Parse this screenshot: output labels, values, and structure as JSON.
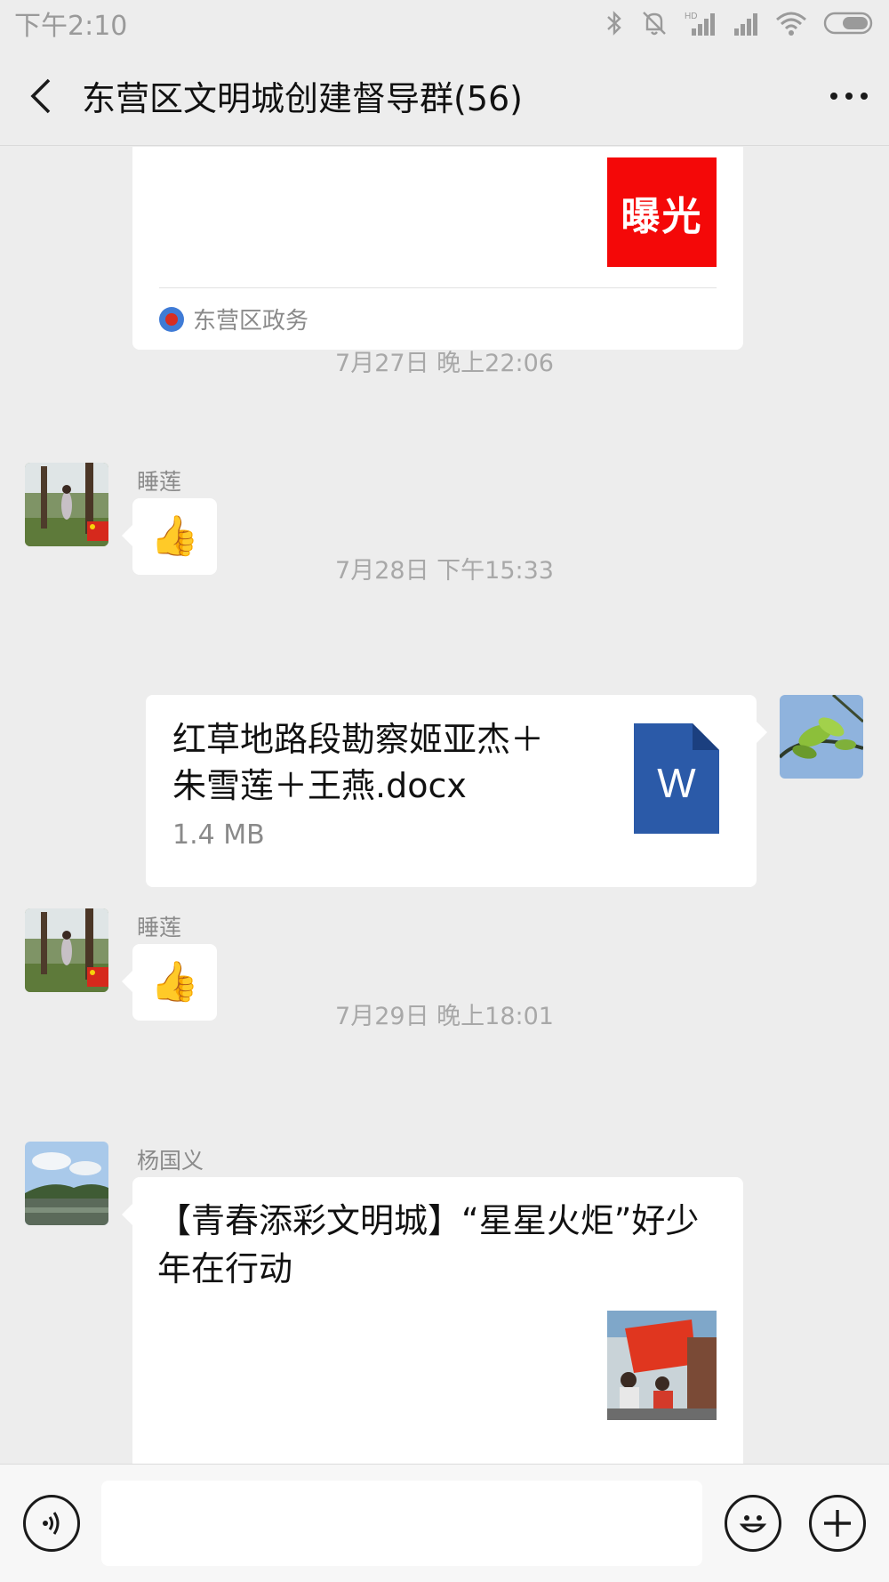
{
  "status": {
    "time": "下午2:10"
  },
  "header": {
    "title": "东营区文明城创建督导群(56)"
  },
  "messages": {
    "article1": {
      "image_text": "曝光",
      "source": "东营区政务"
    },
    "time1": "7月27日 晚上22:06",
    "msg1": {
      "sender": "睡莲",
      "emoji": "👍"
    },
    "time2": "7月28日 下午15:33",
    "file": {
      "name": "红草地路段勘察姬亚杰＋朱雪莲＋王燕.docx",
      "size": "1.4 MB",
      "icon_letter": "W"
    },
    "msg2": {
      "sender": "睡莲",
      "emoji": "👍"
    },
    "time3": "7月29日 晚上18:01",
    "article2": {
      "sender": "杨国义",
      "title": "【青春添彩文明城】“星星火炬”好少年在行动"
    }
  },
  "colors": {
    "background": "#ededed",
    "bubble": "#ffffff",
    "exposure_red": "#f40808",
    "word_blue": "#2b5aa8"
  },
  "icons": [
    "back-arrow-icon",
    "more-icon",
    "bluetooth-icon",
    "mute-bell-icon",
    "signal-icon",
    "wifi-icon",
    "battery-icon",
    "voice-icon",
    "emoji-icon",
    "plus-icon"
  ]
}
